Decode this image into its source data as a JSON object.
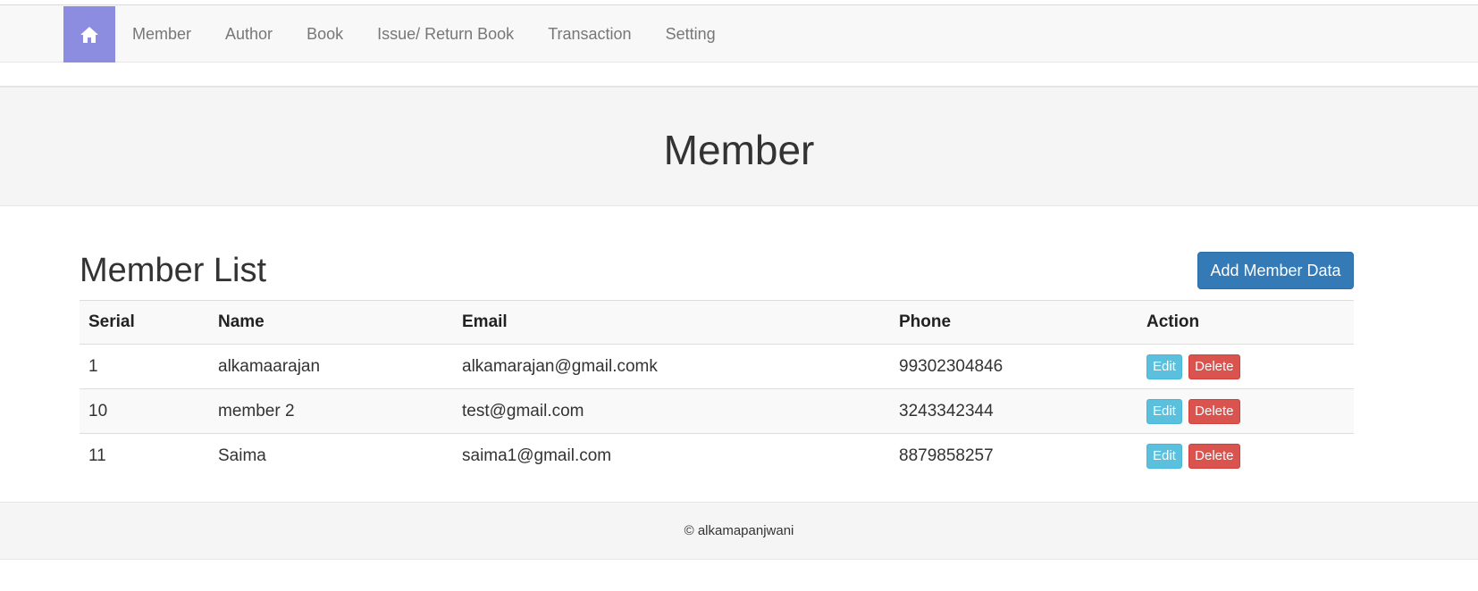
{
  "nav": {
    "home_icon": "home-icon",
    "items": [
      {
        "label": "Member"
      },
      {
        "label": "Author"
      },
      {
        "label": "Book"
      },
      {
        "label": "Issue/ Return Book"
      },
      {
        "label": "Transaction"
      },
      {
        "label": "Setting"
      }
    ]
  },
  "page": {
    "title": "Member"
  },
  "list": {
    "title": "Member List",
    "add_button_label": "Add Member Data",
    "columns": [
      "Serial",
      "Name",
      "Email",
      "Phone",
      "Action"
    ],
    "rows": [
      {
        "serial": "1",
        "name": "alkamaarajan",
        "email": "alkamarajan@gmail.comk",
        "phone": "99302304846"
      },
      {
        "serial": "10",
        "name": "member 2",
        "email": "test@gmail.com",
        "phone": "3243342344"
      },
      {
        "serial": "11",
        "name": "Saima",
        "email": "saima1@gmail.com",
        "phone": "8879858257"
      }
    ],
    "edit_label": "Edit",
    "delete_label": "Delete"
  },
  "footer": {
    "text": "© alkamapanjwani"
  },
  "colors": {
    "home_accent": "#8c8ce0",
    "primary": "#337ab7",
    "info": "#5bc0de",
    "danger": "#d9534f"
  }
}
